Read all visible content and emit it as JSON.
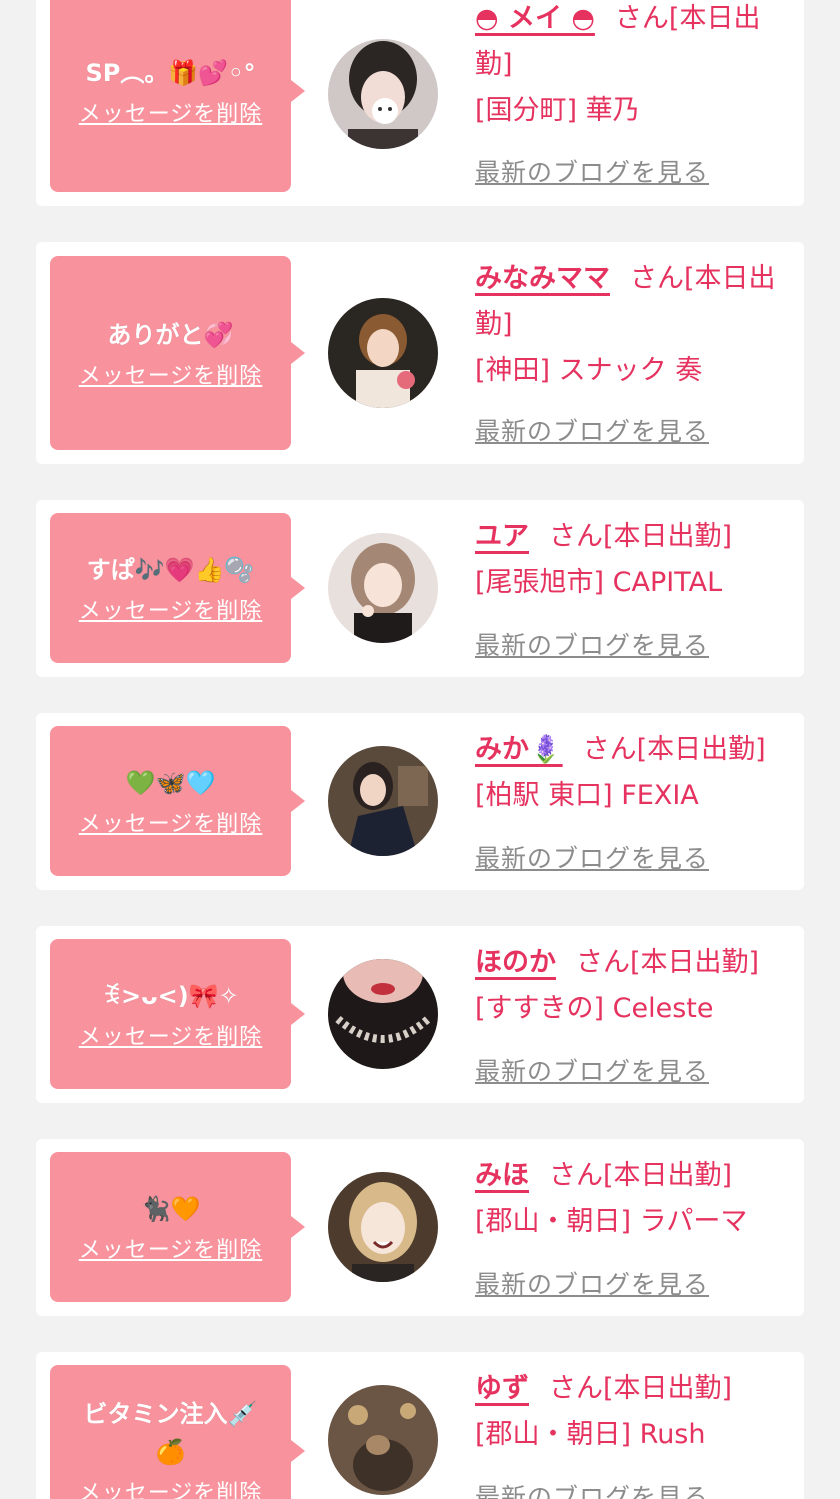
{
  "delete_label": "メッセージを削除",
  "blog_label": "最新のブログを見る",
  "accent_color": "#e5325f",
  "bubble_color": "#f8939d",
  "items": [
    {
      "message": "SP︵。🎁💕◦°",
      "message2": "",
      "name": "◓ メイ ◓",
      "suffix": "さん[本日出勤]",
      "shop": "[国分町] 華乃"
    },
    {
      "message": "ありがと💞",
      "message2": "",
      "name": "みなみママ",
      "suffix": "さん[本日出勤]",
      "shop": "[神田] スナック 奏"
    },
    {
      "message": "すぱ🎶💗👍🫧",
      "message2": "",
      "name": "ユア",
      "suffix": "さん[本日出勤]",
      "shop": "[尾張旭市] CAPITAL"
    },
    {
      "message": "💚🦋🩵",
      "message2": "",
      "name": "みか🪻",
      "suffix": "さん[本日出勤]",
      "shop": "[柏駅 東口] FEXIA"
    },
    {
      "message": "ꉂ>ᴗ<)🎀✧",
      "message2": "",
      "name": "ほのか",
      "suffix": "さん[本日出勤]",
      "shop": "[すすきの] Celeste"
    },
    {
      "message": "🐈‍⬛🧡",
      "message2": "",
      "name": "みほ",
      "suffix": "さん[本日出勤]",
      "shop": "[郡山・朝日] ラパーマ"
    },
    {
      "message": "ビタミン注入💉",
      "message2": "🍊",
      "name": "ゆず",
      "suffix": "さん[本日出勤]",
      "shop": "[郡山・朝日] Rush"
    }
  ]
}
